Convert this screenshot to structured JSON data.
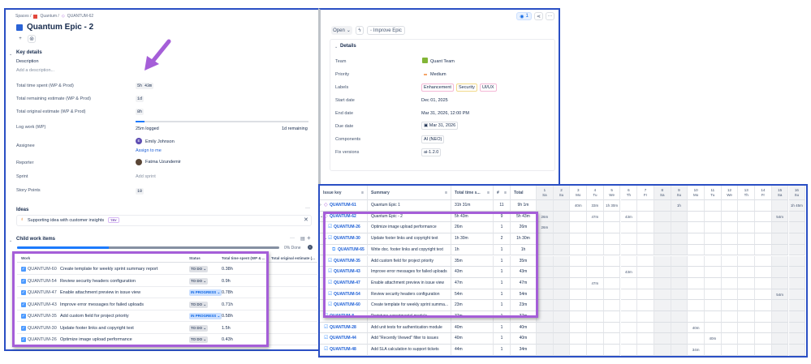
{
  "left": {
    "breadcrumb": {
      "spaces": "Spaces /",
      "project": "Quantum /",
      "issue": "QUANTUM-62"
    },
    "title": "Quantum Epic - 2",
    "key_details": {
      "heading": "Key details",
      "description_label": "Description",
      "description_placeholder": "Add a description...",
      "fields": {
        "time_spent": {
          "label": "Total time spent (WP & Prod)",
          "value": "5h 43m"
        },
        "remaining": {
          "label": "Total remaining estimate (WP & Prod)",
          "value": "1d"
        },
        "original": {
          "label": "Total original estimate (WP & Prod)",
          "value": "8h"
        },
        "log_work": {
          "label": "Log work (WP)",
          "logged": "25m logged",
          "remaining": "1d remaining",
          "progress_pct": 5
        },
        "assignee": {
          "label": "Assignee",
          "initial": "E",
          "name": "Emily Johnson",
          "assign_link": "Assign to me"
        },
        "reporter": {
          "label": "Reporter",
          "name": "Fatma Uzundemir"
        },
        "sprint": {
          "label": "Sprint",
          "value": "Add sprint"
        },
        "story_points": {
          "label": "Story Points",
          "value": "10"
        }
      }
    },
    "ideas": {
      "heading": "Ideas",
      "item": "Supporting idea with customer insights",
      "badge": "TRY"
    },
    "child_items": {
      "heading": "Child work items",
      "done_label": "0% Done",
      "progress_pct": 35,
      "columns": [
        "Work",
        "Status",
        "Total time spent (WP & ...",
        "Total original estimate (..."
      ],
      "rows": [
        {
          "key": "QUANTUM-60",
          "title": "Create template for weekly sprint summary report",
          "status": "TO DO",
          "time": "0.38h"
        },
        {
          "key": "QUANTUM-54",
          "title": "Review security headers configuration",
          "status": "TO DO",
          "time": "0.9h"
        },
        {
          "key": "QUANTUM-47",
          "title": "Enable attachment preview in issue view",
          "status": "IN PROGRESS",
          "time": "0.78h"
        },
        {
          "key": "QUANTUM-43",
          "title": "Improve error messages for failed uploads",
          "status": "TO DO",
          "time": "0.71h"
        },
        {
          "key": "QUANTUM-35",
          "title": "Add custom field for project priority",
          "status": "IN PROGRESS",
          "time": "0.58h"
        },
        {
          "key": "QUANTUM-30",
          "title": "Update footer links and copyright text",
          "status": "TO DO",
          "time": "1.5h"
        },
        {
          "key": "QUANTUM-26",
          "title": "Optimize image upload performance",
          "status": "TO DO",
          "time": "0.43h"
        }
      ]
    }
  },
  "right": {
    "watchers": "1",
    "status_button": "Open",
    "improve_button": "Improve Epic",
    "details": {
      "heading": "Details",
      "team": {
        "label": "Team",
        "value": "Quant Team"
      },
      "priority": {
        "label": "Priority",
        "value": "Medium"
      },
      "labels": {
        "label": "Labels",
        "values": [
          "Enhancement",
          "Security",
          "UI/UX"
        ]
      },
      "start_date": {
        "label": "Start date",
        "value": "Dec 01, 2025"
      },
      "end_date": {
        "label": "End date",
        "value": "Mar 31, 2026, 12:00 PM"
      },
      "due_date": {
        "label": "Due date",
        "value": "Mar 31, 2026"
      },
      "components": {
        "label": "Components",
        "value": "AI (NEO)"
      },
      "fix_versions": {
        "label": "Fix versions",
        "value": "ai-1.2.0"
      }
    }
  },
  "timesheet": {
    "columns": {
      "key": "Issue key",
      "summary": "Summary",
      "time": "Total time s...",
      "count": "#",
      "total": "Total"
    },
    "days": [
      {
        "n": "1",
        "d": "Sa",
        "wk": true
      },
      {
        "n": "2",
        "d": "Su",
        "wk": true
      },
      {
        "n": "3",
        "d": "Mo"
      },
      {
        "n": "4",
        "d": "Tu"
      },
      {
        "n": "5",
        "d": "We"
      },
      {
        "n": "6",
        "d": "Th"
      },
      {
        "n": "7",
        "d": "Fr"
      },
      {
        "n": "8",
        "d": "Sa",
        "wk": true
      },
      {
        "n": "9",
        "d": "Su",
        "wk": true
      },
      {
        "n": "10",
        "d": "Mo"
      },
      {
        "n": "11",
        "d": "Tu"
      },
      {
        "n": "12",
        "d": "We"
      },
      {
        "n": "13",
        "d": "Th"
      },
      {
        "n": "14",
        "d": "Fr"
      },
      {
        "n": "15",
        "d": "Sa",
        "wk": true
      },
      {
        "n": "16",
        "d": "Su",
        "wk": true
      }
    ],
    "rows": [
      {
        "key": "QUANTUM-61",
        "summary": "Quantum Epic 1",
        "time": "31h 31m",
        "count": "11",
        "total": "9h 1m",
        "icon": "epic",
        "chev": "›",
        "lvl": 0,
        "cells": {
          "3": "40m",
          "4": "33m",
          "5": "1h 30m",
          "9": "1h",
          "16": "1h 45m"
        }
      },
      {
        "key": "QUANTUM-62",
        "summary": "Quantum Epic - 2",
        "time": "5h 43m",
        "count": "9",
        "total": "5h 43m",
        "icon": "epic",
        "chev": "⌄",
        "lvl": 0,
        "cells": {
          "1": "26m",
          "4": "47m",
          "6": "43m",
          "15": "54m"
        }
      },
      {
        "key": "QUANTUM-26",
        "summary": "Optimize image upload performance",
        "time": "26m",
        "count": "1",
        "total": "26m",
        "icon": "task",
        "lvl": 1,
        "cells": {
          "1": "26m"
        }
      },
      {
        "key": "QUANTUM-30",
        "summary": "Update footer links and copyright text",
        "time": "1h 30m",
        "count": "2",
        "total": "1h 30m",
        "icon": "task",
        "chev": "⌄",
        "lvl": 1,
        "cells": {}
      },
      {
        "key": "QUANTUM-65",
        "summary": "Write doc. footer links and copyright text",
        "time": "1h",
        "count": "1",
        "total": "1h",
        "icon": "sub",
        "lvl": 2,
        "cells": {}
      },
      {
        "key": "QUANTUM-35",
        "summary": "Add custom field for project priority",
        "time": "35m",
        "count": "1",
        "total": "35m",
        "icon": "task",
        "lvl": 1,
        "cells": {}
      },
      {
        "key": "QUANTUM-43",
        "summary": "Improve error messages for failed uploads",
        "time": "43m",
        "count": "1",
        "total": "43m",
        "icon": "task",
        "lvl": 1,
        "cells": {
          "6": "43m"
        }
      },
      {
        "key": "QUANTUM-47",
        "summary": "Enable attachment preview in issue view",
        "time": "47m",
        "count": "1",
        "total": "47m",
        "icon": "task",
        "lvl": 1,
        "cells": {
          "4": "47m"
        }
      },
      {
        "key": "QUANTUM-54",
        "summary": "Review security headers configuration",
        "time": "54m",
        "count": "1",
        "total": "54m",
        "icon": "task",
        "lvl": 1,
        "cells": {
          "15": "54m"
        }
      },
      {
        "key": "QUANTUM-60",
        "summary": "Create template for weekly sprint summa...",
        "time": "23m",
        "count": "1",
        "total": "23m",
        "icon": "task",
        "lvl": 1,
        "cells": {}
      },
      {
        "key": "QUANTUM-8",
        "summary": "Prototype experimental module",
        "time": "37m",
        "count": "1",
        "total": "37m",
        "icon": "task",
        "lvl": 0,
        "cells": {}
      },
      {
        "key": "QUANTUM-28",
        "summary": "Add unit tests for authentication module",
        "time": "40m",
        "count": "1",
        "total": "40m",
        "icon": "task",
        "lvl": 0,
        "cells": {
          "10": "40m"
        }
      },
      {
        "key": "QUANTUM-44",
        "summary": "Add \"Recently Viewed\" filter to issues",
        "time": "40m",
        "count": "1",
        "total": "40m",
        "icon": "task",
        "lvl": 0,
        "cells": {
          "11": "40m"
        }
      },
      {
        "key": "QUANTUM-48",
        "summary": "Add SLA calculation to support tickets",
        "time": "44m",
        "count": "1",
        "total": "34m",
        "icon": "task",
        "lvl": 0,
        "cells": {
          "10": "34m"
        }
      }
    ]
  },
  "colors": {
    "frame": "#2a4fc4",
    "highlight": "#a55ed8",
    "link": "#1d5fd6"
  }
}
